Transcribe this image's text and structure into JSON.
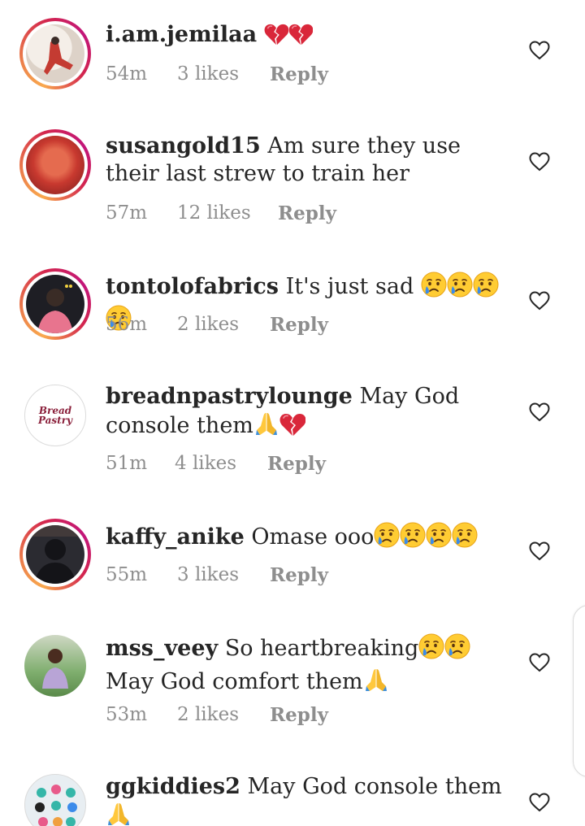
{
  "comments": [
    {
      "username": "i.am.jemilaa",
      "text": "",
      "emojis": [
        "broken-heart",
        "broken-heart"
      ],
      "time": "54m",
      "likes": "3 likes",
      "reply": "Reply",
      "story_ring": true,
      "avatar_colors": [
        "#f2ece6",
        "#c43b32",
        "#3b2c28"
      ]
    },
    {
      "username": "susangold15",
      "text": "Am sure they use their last strew to train her",
      "emojis": [],
      "time": "57m",
      "likes": "12 likes",
      "reply": "Reply",
      "story_ring": true,
      "avatar_colors": [
        "#c8392f",
        "#e56b4f",
        "#7a1c1c"
      ]
    },
    {
      "username": "tontolofabrics",
      "text": "It's just sad",
      "emojis": [
        "crying-face",
        "crying-face",
        "crying-face",
        "crying-face"
      ],
      "time": "56m",
      "likes": "2 likes",
      "reply": "Reply",
      "story_ring": true,
      "avatar_colors": [
        "#1e1e24",
        "#e8748e",
        "#3a3a44"
      ]
    },
    {
      "username": "breadnpastrylounge",
      "text": "May God console them",
      "emojis": [
        "folded-hands",
        "broken-heart"
      ],
      "time": "51m",
      "likes": "4 likes",
      "reply": "Reply",
      "story_ring": false,
      "avatar_logo_line1": "Bread",
      "avatar_logo_line2": "Pastry"
    },
    {
      "username": "kaffy_anike",
      "text": "Omase ooo",
      "emojis": [
        "crying-face",
        "crying-face",
        "crying-face",
        "crying-face"
      ],
      "time": "55m",
      "likes": "3 likes",
      "reply": "Reply",
      "story_ring": true,
      "avatar_colors": [
        "#141418",
        "#2b2b31",
        "#5a4a44"
      ]
    },
    {
      "username": "mss_veey",
      "text": "So heartbreaking",
      "text2": "May God comfort them",
      "emojis": [
        "crying-face",
        "crying-face"
      ],
      "emojis2": [
        "folded-hands"
      ],
      "time": "53m",
      "likes": "2 likes",
      "reply": "Reply",
      "story_ring": false,
      "avatar_colors": [
        "#7fae6e",
        "#b8a4d6",
        "#cfd8c4"
      ]
    },
    {
      "username": "ggkiddies2",
      "text": "May God console them",
      "emojis": [
        "folded-hands"
      ],
      "time": "",
      "likes": "",
      "reply": "",
      "story_ring": false,
      "avatar_colors": [
        "#e8eef2",
        "#35b6a8",
        "#222"
      ]
    }
  ],
  "colors": {
    "text": "#262626",
    "meta": "#8e8e8e",
    "story_ring_start": "#f9a94e",
    "story_ring_end": "#c2167a"
  }
}
